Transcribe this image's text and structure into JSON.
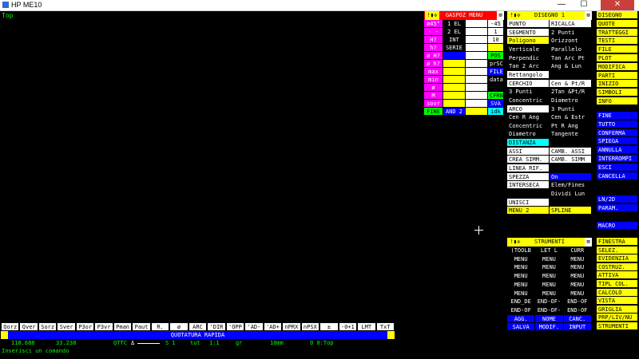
{
  "window": {
    "title": "HP ME10",
    "minimize": "—",
    "maximize": "☐",
    "close": "✕"
  },
  "viewport": {
    "label": "Top"
  },
  "gaspoz": {
    "title": "GASPOZ MENU",
    "col1": [
      {
        "t": "ø45°",
        "c": "bm"
      },
      {
        "t": "- -",
        "c": "bm"
      },
      {
        "t": "H?",
        "c": "bm"
      },
      {
        "t": "h?",
        "c": "bm"
      },
      {
        "t": "ø H?",
        "c": "bm"
      },
      {
        "t": "ø h?",
        "c": "bm"
      },
      {
        "t": "max",
        "c": "bm"
      },
      {
        "t": "min",
        "c": "bm"
      },
      {
        "t": "ø",
        "c": "bm"
      },
      {
        "t": "M",
        "c": "bm"
      },
      {
        "t": "sovr",
        "c": "bm"
      },
      {
        "t": "FINE",
        "c": "bg"
      }
    ],
    "col2": [
      {
        "t": "1 EL",
        "c": "bk"
      },
      {
        "t": "2 EL",
        "c": "bk"
      },
      {
        "t": "INT",
        "c": "bk"
      },
      {
        "t": "SERIE",
        "c": "bk"
      },
      {
        "t": "",
        "c": "bb"
      },
      {
        "t": "",
        "c": "by"
      },
      {
        "t": "",
        "c": "by"
      },
      {
        "t": "",
        "c": "by"
      },
      {
        "t": "",
        "c": "by"
      },
      {
        "t": "",
        "c": "by"
      },
      {
        "t": "",
        "c": "by"
      },
      {
        "t": "AND 2",
        "c": "bb"
      }
    ],
    "col3": [
      {
        "t": "",
        "c": "bw"
      },
      {
        "t": "",
        "c": "bw"
      },
      {
        "t": "",
        "c": "bw"
      },
      {
        "t": "",
        "c": "bw"
      },
      {
        "t": "",
        "c": "bw"
      },
      {
        "t": "",
        "c": "bw"
      },
      {
        "t": "",
        "c": "bw"
      },
      {
        "t": "",
        "c": "bw"
      },
      {
        "t": "",
        "c": "bw"
      },
      {
        "t": "",
        "c": "bw"
      },
      {
        "t": "",
        "c": "bw"
      },
      {
        "t": "",
        "c": "by"
      }
    ],
    "col4": [
      {
        "t": "-45",
        "c": "bw"
      },
      {
        "t": "1",
        "c": "bw"
      },
      {
        "t": "10",
        "c": "bw"
      },
      {
        "t": "",
        "c": "by"
      },
      {
        "t": "POS",
        "c": "bg"
      },
      {
        "t": "prSC",
        "c": "bk"
      },
      {
        "t": "FILE",
        "c": "bb"
      },
      {
        "t": "data",
        "c": "bk"
      },
      {
        "t": "",
        "c": "bk"
      },
      {
        "t": "CFRN",
        "c": "bg"
      },
      {
        "t": "SVA",
        "c": "bb"
      },
      {
        "t": "idk",
        "c": "bc"
      }
    ]
  },
  "disegno": {
    "title": "DISEGNO 1",
    "rows": [
      [
        {
          "t": "PUNTO",
          "c": "bw"
        },
        {
          "t": "RICALCA",
          "c": "bw"
        }
      ],
      [
        {
          "t": "SEGMENTO",
          "c": "bw"
        },
        {
          "t": "2 Punti",
          "c": "bk"
        }
      ],
      [
        {
          "t": "Poligono",
          "c": "by"
        },
        {
          "t": "Orizzont",
          "c": "bk"
        }
      ],
      [
        {
          "t": "Verticale",
          "c": "bk"
        },
        {
          "t": "Parallelo",
          "c": "bk"
        }
      ],
      [
        {
          "t": "Perpendic",
          "c": "bk"
        },
        {
          "t": "Tan Arc Pt",
          "c": "bk"
        }
      ],
      [
        {
          "t": "Tan 2 Arc",
          "c": "bk"
        },
        {
          "t": "Ang & Lun",
          "c": "bk"
        }
      ],
      [
        {
          "t": "Rettangolo",
          "c": "bw"
        },
        {
          "t": "",
          "c": "bk"
        }
      ],
      [
        {
          "t": "CERCHIO",
          "c": "bw"
        },
        {
          "t": "Cen & Pt/R",
          "c": "bw"
        }
      ],
      [
        {
          "t": "3 Punti",
          "c": "bk"
        },
        {
          "t": "2Tan &Pt/R",
          "c": "bk"
        }
      ],
      [
        {
          "t": "Concentric",
          "c": "bk"
        },
        {
          "t": "Diametro",
          "c": "bk"
        }
      ],
      [
        {
          "t": "ARCO",
          "c": "bw"
        },
        {
          "t": "3 Punti",
          "c": "bk"
        }
      ],
      [
        {
          "t": "Cen R Ang",
          "c": "bk"
        },
        {
          "t": "Cen & Estr",
          "c": "bk"
        }
      ],
      [
        {
          "t": "Concentric",
          "c": "bk"
        },
        {
          "t": "Pt R Ang",
          "c": "bk"
        }
      ],
      [
        {
          "t": "Diametro",
          "c": "bk"
        },
        {
          "t": "Tangente",
          "c": "bk"
        }
      ],
      [
        {
          "t": "DISTANZA",
          "c": "bc"
        },
        {
          "t": "",
          "c": "bk"
        }
      ],
      [
        {
          "t": "ASSI",
          "c": "bw"
        },
        {
          "t": "CAMB. ASSI",
          "c": "bw"
        }
      ],
      [
        {
          "t": "CREA SIMM.",
          "c": "bw"
        },
        {
          "t": "CAMB. SIMM",
          "c": "bw"
        }
      ],
      [
        {
          "t": "LINEA RIF.",
          "c": "bw"
        },
        {
          "t": "",
          "c": "bk"
        }
      ],
      [
        {
          "t": "SPEZZA",
          "c": "bw"
        },
        {
          "t": "On",
          "c": "bb"
        }
      ],
      [
        {
          "t": "INTERSECA",
          "c": "bw"
        },
        {
          "t": "Elem/Fines",
          "c": "bk"
        }
      ],
      [
        {
          "t": "",
          "c": "bk"
        },
        {
          "t": "Dividi Lun",
          "c": "bk"
        }
      ],
      [
        {
          "t": "UNISCI",
          "c": "bw"
        },
        {
          "t": "",
          "c": "bk"
        }
      ],
      [
        {
          "t": "MENU 2",
          "c": "by"
        },
        {
          "t": "SPLINE",
          "c": "by"
        }
      ]
    ]
  },
  "strumenti": {
    "title": "STRUMENTI",
    "rows": [
      [
        "(TOOLB",
        "LET L",
        "CURR"
      ],
      [
        "MENU",
        "MENU",
        "MENU"
      ],
      [
        "MENU",
        "MENU",
        "MENU"
      ],
      [
        "MENU",
        "MENU",
        "MENU"
      ],
      [
        "MENU",
        "MENU",
        "MENU"
      ],
      [
        "MENU",
        "MENU",
        "MENU"
      ],
      [
        "END_DE",
        "END-OF-",
        "END-OF"
      ],
      [
        "END-OF",
        "END-OF-",
        "END-OF"
      ],
      [
        "AGG.",
        "NOME",
        "CANC."
      ],
      [
        "SALVA",
        "MODIF.",
        "INPUT"
      ]
    ]
  },
  "main_menu": {
    "group1": [
      "DISEGNO",
      "QUOTE",
      "TRATTEGGI",
      "TESTI",
      "FILE",
      "PLOT",
      "MODIFICA",
      "PARTI",
      "INIZIO",
      "SIMBOLI",
      "INFO"
    ],
    "group2": [
      "FINE",
      "TUTTO",
      "CONFERMA",
      "SPIEGA",
      "ANNULLA",
      "INTERROMPI",
      "ESCI",
      "CANCELLA"
    ],
    "group3": [
      "LN/2D",
      "PARAM."
    ],
    "group4": [
      "MACRO"
    ],
    "group5": [
      "FINESTRA",
      "SELEZ.",
      "EVIDENZIA",
      "COSTRUZ.",
      "ATTIVA",
      "TIPL COL.",
      "CALCOLO",
      "VISTA",
      "GRIGLIA",
      "PRP/LIV/NU",
      "STRUMENTI"
    ]
  },
  "toolbar": [
    "Qorz",
    "Qver",
    "Sorz",
    "Sver",
    "P3or",
    "P3vr",
    "Pman",
    "Paut",
    "R.",
    "ø",
    "ARC",
    "'DIR",
    "'OPP",
    "'AD-",
    "'AD+",
    "nPRX",
    "nPSX",
    "±",
    "-0+1",
    "LMT",
    "TxT"
  ],
  "quick_label": "QUOTATURA RAPIDA",
  "status": {
    "x": "118.688",
    "y": "33.238",
    "qttc": "QTTC",
    "qttc_sym": "Δ",
    "s": "S 1",
    "tut": "tut",
    "scale": "1:1",
    "gr": "gr",
    "unit": "10mm",
    "view": "0 0:Top"
  },
  "prompt": "Inserisci un comando",
  "colors": {
    "yellow": "#ffff00",
    "blue": "#0000ff",
    "magenta": "#ff00ff",
    "cyan": "#00ffff",
    "green": "#00ff00",
    "red": "#ff0000"
  }
}
